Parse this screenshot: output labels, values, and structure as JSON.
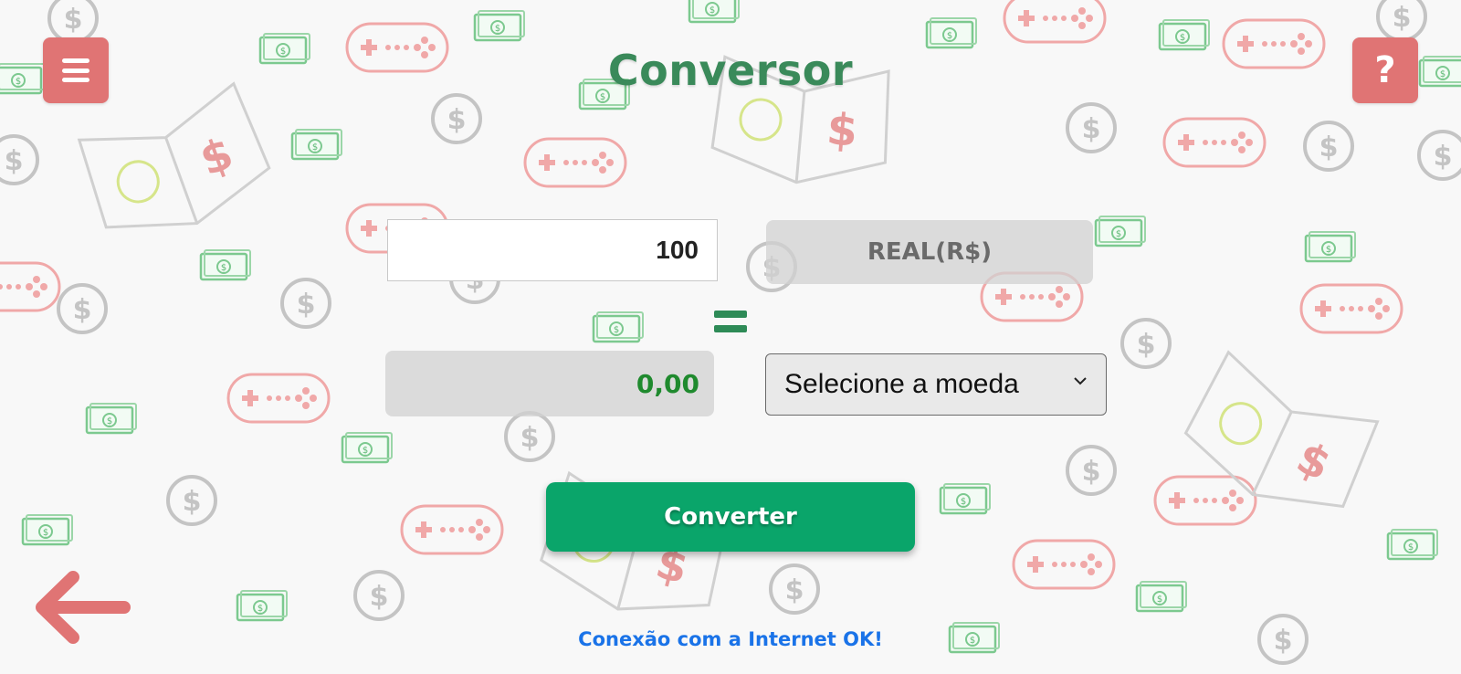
{
  "app": {
    "title": "Conversor"
  },
  "header": {
    "menu_icon": "hamburger-menu-icon",
    "help_label": "?"
  },
  "converter": {
    "amount_value": "100",
    "from_currency": "REAL(R$)",
    "equals_icon": "equals-sign-icon",
    "result_value": "0,00",
    "to_currency_placeholder": "Selecione a moeda",
    "convert_label": "Converter"
  },
  "footer": {
    "back_icon": "back-arrow-icon",
    "status_text": "Conexão com a Internet OK!"
  },
  "colors": {
    "accent_red": "#e07474",
    "title_green": "#3a8a5a",
    "button_green": "#0aa56a",
    "status_blue": "#1a73e8",
    "result_green": "#1f8a2e"
  }
}
